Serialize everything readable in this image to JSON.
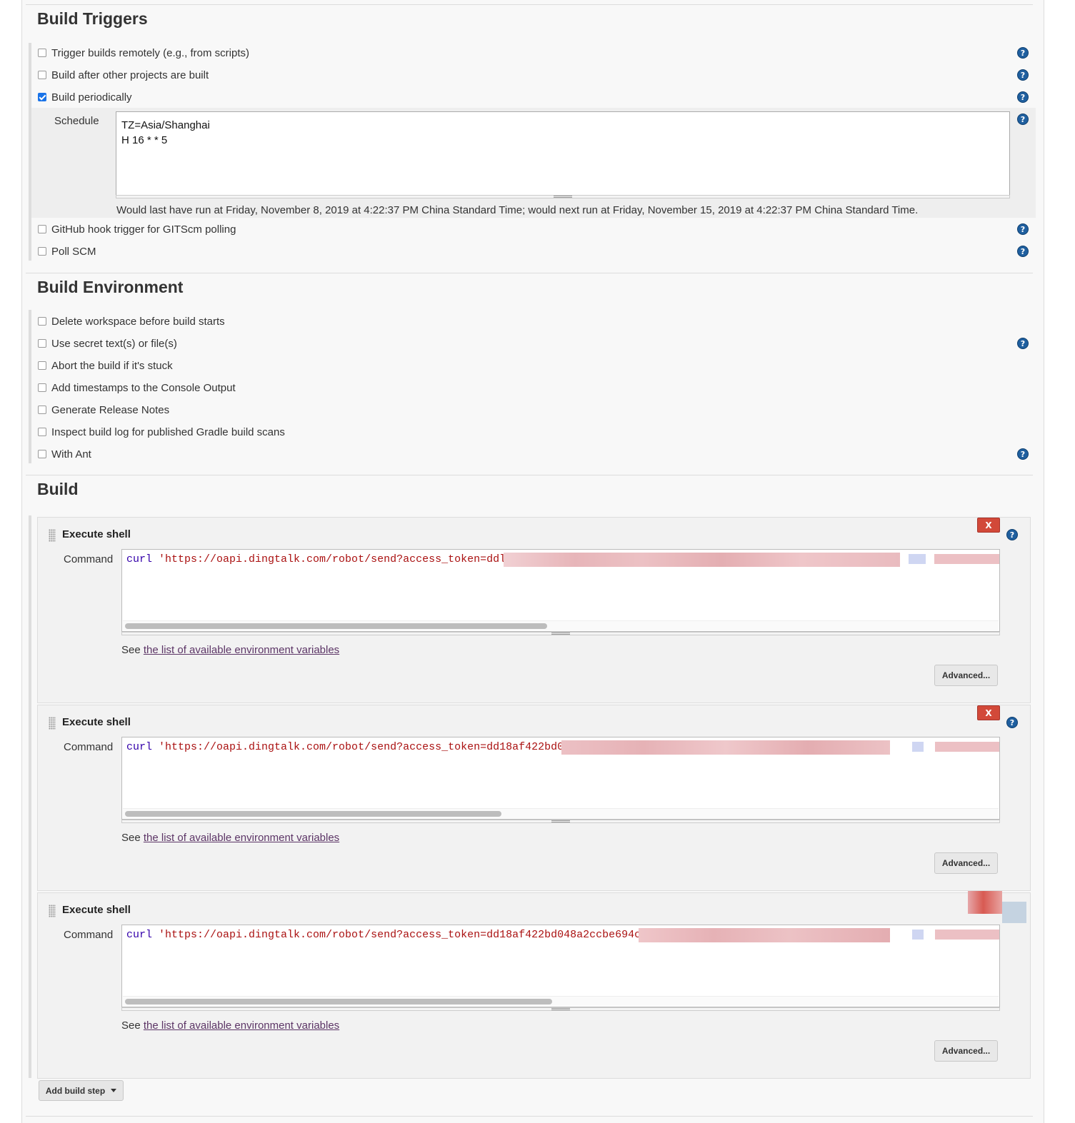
{
  "sections": {
    "triggers_title": "Build Triggers",
    "environment_title": "Build Environment",
    "build_title": "Build"
  },
  "triggers": [
    {
      "label": "Trigger builds remotely (e.g., from scripts)",
      "checked": false,
      "help": true
    },
    {
      "label": "Build after other projects are built",
      "checked": false,
      "help": true
    },
    {
      "label": "Build periodically",
      "checked": true,
      "help": true
    },
    {
      "label": "GitHub hook trigger for GITScm polling",
      "checked": false,
      "help": true
    },
    {
      "label": "Poll SCM",
      "checked": false,
      "help": true
    }
  ],
  "schedule": {
    "label": "Schedule",
    "lines": [
      "TZ=Asia/Shanghai",
      "H 16 * * 5"
    ],
    "status": "Would last have run at Friday, November 8, 2019 at 4:22:37 PM China Standard Time; would next run at Friday, November 15, 2019 at 4:22:37 PM China Standard Time."
  },
  "environment": [
    {
      "label": "Delete workspace before build starts",
      "checked": false,
      "help": false
    },
    {
      "label": "Use secret text(s) or file(s)",
      "checked": false,
      "help": true
    },
    {
      "label": "Abort the build if it's stuck",
      "checked": false,
      "help": false
    },
    {
      "label": "Add timestamps to the Console Output",
      "checked": false,
      "help": false
    },
    {
      "label": "Generate Release Notes",
      "checked": false,
      "help": false
    },
    {
      "label": "Inspect build log for published Gradle build scans",
      "checked": false,
      "help": false
    },
    {
      "label": "With Ant",
      "checked": false,
      "help": true
    }
  ],
  "steps": [
    {
      "title": "Execute shell",
      "command_label": "Command",
      "cmd_keyword": "curl",
      "cmd_rest": " 'https://oapi.dingtalk.com/robot/send?access_token=ddl",
      "delete_label": "X",
      "advanced_label": "Advanced...",
      "env_prefix": "See ",
      "env_link": "the list of available environment variables"
    },
    {
      "title": "Execute shell",
      "command_label": "Command",
      "cmd_keyword": "curl",
      "cmd_rest": " 'https://oapi.dingtalk.com/robot/send?access_token=dd18af422bd0",
      "delete_label": "X",
      "advanced_label": "Advanced...",
      "env_prefix": "See ",
      "env_link": "the list of available environment variables"
    },
    {
      "title": "Execute shell",
      "command_label": "Command",
      "cmd_keyword": "curl",
      "cmd_rest": " 'https://oapi.dingtalk.com/robot/send?access_token=dd18af422bd048a2ccbe694c",
      "delete_label": "X",
      "advanced_label": "Advanced...",
      "env_prefix": "See ",
      "env_link": "the list of available environment variables"
    }
  ],
  "add_step": {
    "label": "Add build step"
  },
  "colors": {
    "help_icon": "#1f5f9f",
    "delete_button": "#d24939",
    "link": "#5c3566",
    "checkbox_checked": "#1a73e8",
    "redaction": "#e7b5b9"
  }
}
